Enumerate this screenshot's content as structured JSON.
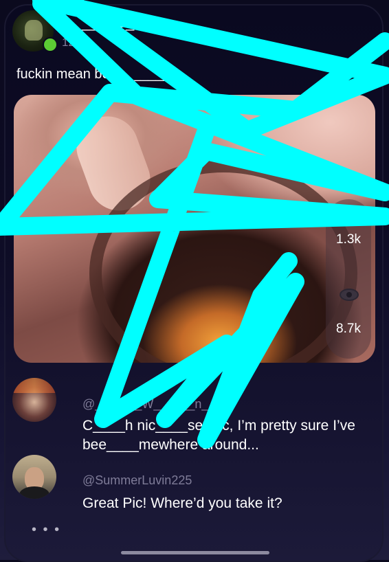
{
  "post": {
    "username": "_____r13_",
    "subline": "12",
    "caption": "fuckin mean be________y",
    "like_count": "1.3k",
    "view_count": "8.7k"
  },
  "comments": [
    {
      "handle": "@___niel_W______n___",
      "text": "C____h nic____set pic, I’m pretty sure I’ve bee____mewhere around..."
    },
    {
      "handle": "@SummerLuvin225",
      "text": "Great Pic! Where’d you take it?"
    }
  ],
  "more_label": "• • •",
  "overlay": {
    "scribble_color": "#00ffff"
  }
}
